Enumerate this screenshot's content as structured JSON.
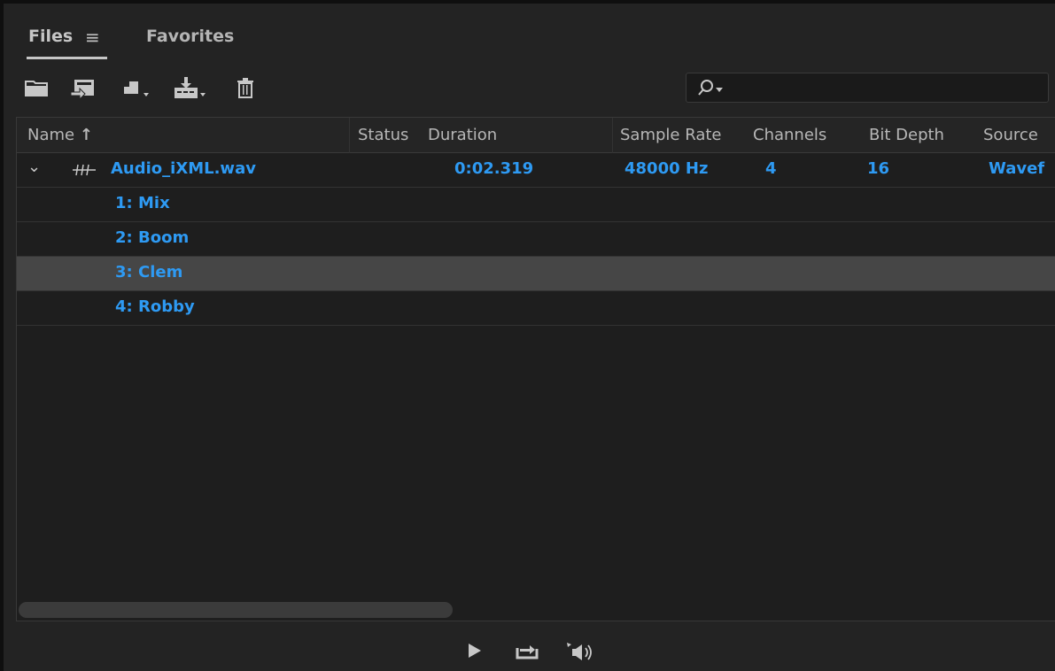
{
  "tabs": {
    "files_label": "Files",
    "menu_glyph": "≡",
    "favorites_label": "Favorites"
  },
  "toolbar": {
    "icons": [
      "folder-icon",
      "import-icon",
      "insert-icon",
      "export-icon",
      "trash-icon"
    ],
    "search_placeholder": ""
  },
  "table": {
    "columns": {
      "name": "Name",
      "sort_glyph": "↑",
      "status": "Status",
      "duration": "Duration",
      "sample_rate": "Sample Rate",
      "channels": "Channels",
      "bit_depth": "Bit Depth",
      "source": "Source"
    },
    "file": {
      "expand_glyph": "⌄",
      "name": "Audio_iXML.wav",
      "duration": "0:02.319",
      "sample_rate": "48000 Hz",
      "channels": "4",
      "bit_depth": "16",
      "source": "Wavef"
    },
    "channels_list": [
      "1: Mix",
      "2: Boom",
      "3: Clem",
      "4: Robby"
    ],
    "selected_channel": "3: Clem"
  },
  "transport": {
    "icons": [
      "play-icon",
      "loop-icon",
      "autoplay-volume-icon"
    ]
  },
  "colors": {
    "accent": "#2e9af3",
    "background": "#232323",
    "selected_row": "#464646"
  }
}
